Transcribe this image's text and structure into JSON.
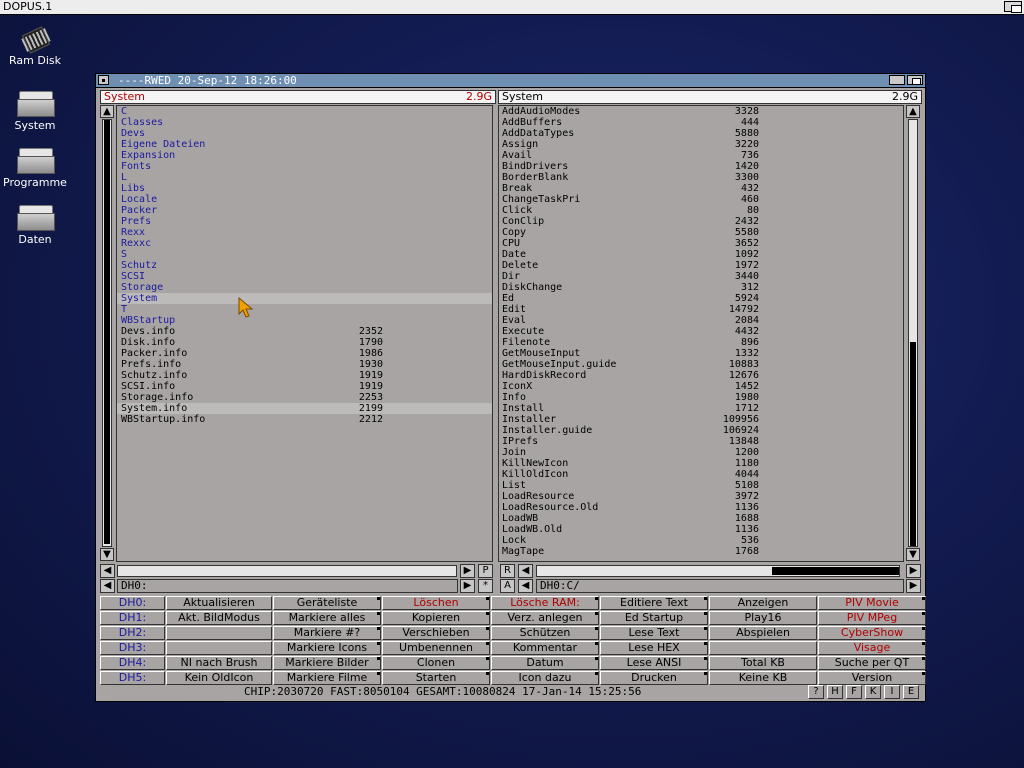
{
  "screen": {
    "title": "DOPUS.1"
  },
  "desktop_icons": [
    {
      "label": "Ram Disk",
      "icon": "chip-icon"
    },
    {
      "label": "System",
      "icon": "drive-icon"
    },
    {
      "label": "Programme",
      "icon": "drive-icon"
    },
    {
      "label": "Daten",
      "icon": "drive-icon"
    }
  ],
  "window": {
    "title": "----RWED 20-Sep-12 18:26:00"
  },
  "left_lister": {
    "name": "System",
    "free": "2.9G",
    "path": "DH0:",
    "entries": [
      {
        "name": "C",
        "size": "",
        "type": "dir"
      },
      {
        "name": "Classes",
        "size": "",
        "type": "dir"
      },
      {
        "name": "Devs",
        "size": "",
        "type": "dir"
      },
      {
        "name": "Eigene Dateien",
        "size": "",
        "type": "dir"
      },
      {
        "name": "Expansion",
        "size": "",
        "type": "dir"
      },
      {
        "name": "Fonts",
        "size": "",
        "type": "dir"
      },
      {
        "name": "L",
        "size": "",
        "type": "dir"
      },
      {
        "name": "Libs",
        "size": "",
        "type": "dir"
      },
      {
        "name": "Locale",
        "size": "",
        "type": "dir"
      },
      {
        "name": "Packer",
        "size": "",
        "type": "dir"
      },
      {
        "name": "Prefs",
        "size": "",
        "type": "dir"
      },
      {
        "name": "Rexx",
        "size": "",
        "type": "dir"
      },
      {
        "name": "Rexxc",
        "size": "",
        "type": "dir"
      },
      {
        "name": "S",
        "size": "",
        "type": "dir"
      },
      {
        "name": "Schutz",
        "size": "",
        "type": "dir"
      },
      {
        "name": "SCSI",
        "size": "",
        "type": "dir"
      },
      {
        "name": "Storage",
        "size": "",
        "type": "dir"
      },
      {
        "name": "System",
        "size": "",
        "type": "dir",
        "highlight": true
      },
      {
        "name": "T",
        "size": "",
        "type": "dir"
      },
      {
        "name": "WBStartup",
        "size": "",
        "type": "dir"
      },
      {
        "name": "Devs.info",
        "size": "2352",
        "type": "file"
      },
      {
        "name": "Disk.info",
        "size": "1790",
        "type": "file"
      },
      {
        "name": "Packer.info",
        "size": "1986",
        "type": "file"
      },
      {
        "name": "Prefs.info",
        "size": "1930",
        "type": "file"
      },
      {
        "name": "Schutz.info",
        "size": "1919",
        "type": "file"
      },
      {
        "name": "SCSI.info",
        "size": "1919",
        "type": "file"
      },
      {
        "name": "Storage.info",
        "size": "2253",
        "type": "file"
      },
      {
        "name": "System.info",
        "size": "2199",
        "type": "file",
        "highlight": true
      },
      {
        "name": "WBStartup.info",
        "size": "2212",
        "type": "file"
      }
    ]
  },
  "right_lister": {
    "name": "System",
    "free": "2.9G",
    "path": "DH0:C/",
    "entries": [
      {
        "name": "AddAudioModes",
        "size": "3328"
      },
      {
        "name": "AddBuffers",
        "size": "444"
      },
      {
        "name": "AddDataTypes",
        "size": "5880"
      },
      {
        "name": "Assign",
        "size": "3220"
      },
      {
        "name": "Avail",
        "size": "736"
      },
      {
        "name": "BindDrivers",
        "size": "1420"
      },
      {
        "name": "BorderBlank",
        "size": "3300"
      },
      {
        "name": "Break",
        "size": "432"
      },
      {
        "name": "ChangeTaskPri",
        "size": "460"
      },
      {
        "name": "Click",
        "size": "80"
      },
      {
        "name": "ConClip",
        "size": "2432"
      },
      {
        "name": "Copy",
        "size": "5580"
      },
      {
        "name": "CPU",
        "size": "3652"
      },
      {
        "name": "Date",
        "size": "1092"
      },
      {
        "name": "Delete",
        "size": "1972"
      },
      {
        "name": "Dir",
        "size": "3440"
      },
      {
        "name": "DiskChange",
        "size": "312"
      },
      {
        "name": "Ed",
        "size": "5924"
      },
      {
        "name": "Edit",
        "size": "14792"
      },
      {
        "name": "Eval",
        "size": "2084"
      },
      {
        "name": "Execute",
        "size": "4432"
      },
      {
        "name": "Filenote",
        "size": "896"
      },
      {
        "name": "GetMouseInput",
        "size": "1332"
      },
      {
        "name": "GetMouseInput.guide",
        "size": "10883"
      },
      {
        "name": "HardDiskRecord",
        "size": "12676"
      },
      {
        "name": "IconX",
        "size": "1452"
      },
      {
        "name": "Info",
        "size": "1980"
      },
      {
        "name": "Install",
        "size": "1712"
      },
      {
        "name": "Installer",
        "size": "109956"
      },
      {
        "name": "Installer.guide",
        "size": "106924"
      },
      {
        "name": "IPrefs",
        "size": "13848"
      },
      {
        "name": "Join",
        "size": "1200"
      },
      {
        "name": "KillNewIcon",
        "size": "1180"
      },
      {
        "name": "KillOldIcon",
        "size": "4044"
      },
      {
        "name": "List",
        "size": "5108"
      },
      {
        "name": "LoadResource",
        "size": "3972"
      },
      {
        "name": "LoadResource.Old",
        "size": "1136"
      },
      {
        "name": "LoadWB",
        "size": "1688"
      },
      {
        "name": "LoadWB.Old",
        "size": "1136"
      },
      {
        "name": "Lock",
        "size": "536"
      },
      {
        "name": "MagTape",
        "size": "1768"
      }
    ]
  },
  "lister_buttons": {
    "left_p": "P",
    "left_star": "*",
    "mid_r": "R",
    "mid_a": "A",
    "scroll_left": "<",
    "scroll_right": ">",
    "scroll_up": "^",
    "scroll_down": "V"
  },
  "scroll": {
    "left_v_position": 0.0,
    "right_v_position": 0.52,
    "right_v_visible": 0.48,
    "right_h_visible": 0.35
  },
  "button_bank": [
    [
      "DH0:",
      "Aktualisieren",
      "Geräteliste",
      "Löschen",
      "Lösche RAM:",
      "Editiere Text",
      "Anzeigen",
      "PIV Movie"
    ],
    [
      "DH1:",
      "Akt. BildModus",
      "Markiere alles",
      "Kopieren",
      "Verz. anlegen",
      "Ed Startup",
      "Play16",
      "PIV MPeg"
    ],
    [
      "DH2:",
      "",
      "Markiere #?",
      "Verschieben",
      "Schützen",
      "Lese Text",
      "Abspielen",
      "CyberShow"
    ],
    [
      "DH3:",
      "",
      "Markiere Icons",
      "Umbenennen",
      "Kommentar",
      "Lese HEX",
      "",
      "Visage"
    ],
    [
      "DH4:",
      "NI nach Brush",
      "Markiere Bilder",
      "Clonen",
      "Datum",
      "Lese ANSI",
      "Total KB",
      "Suche per QT"
    ],
    [
      "DH5:",
      "Kein OldIcon",
      "Markiere Filme",
      "Starten",
      "Icon dazu",
      "Drucken",
      "Keine KB",
      "Version"
    ]
  ],
  "button_bank_colors": {
    "red": [
      "Löschen",
      "Lösche RAM:",
      "PIV Movie",
      "PIV MPeg",
      "CyberShow",
      "Visage"
    ],
    "blue": [
      "DH0:",
      "DH1:",
      "DH2:",
      "DH3:",
      "DH4:",
      "DH5:"
    ]
  },
  "status": {
    "text": "CHIP:2030720  FAST:8050104  GESAMT:10080824  17-Jan-14  15:25:56",
    "buttons": [
      "?",
      "H",
      "F",
      "K",
      "I",
      "E"
    ]
  },
  "colors": {
    "window_bg": "#a8a4a4",
    "title_bar": "#6e8fb2",
    "dir_text": "#1a1a9e",
    "accent_red": "#b00000",
    "desktop": "#131c52"
  }
}
